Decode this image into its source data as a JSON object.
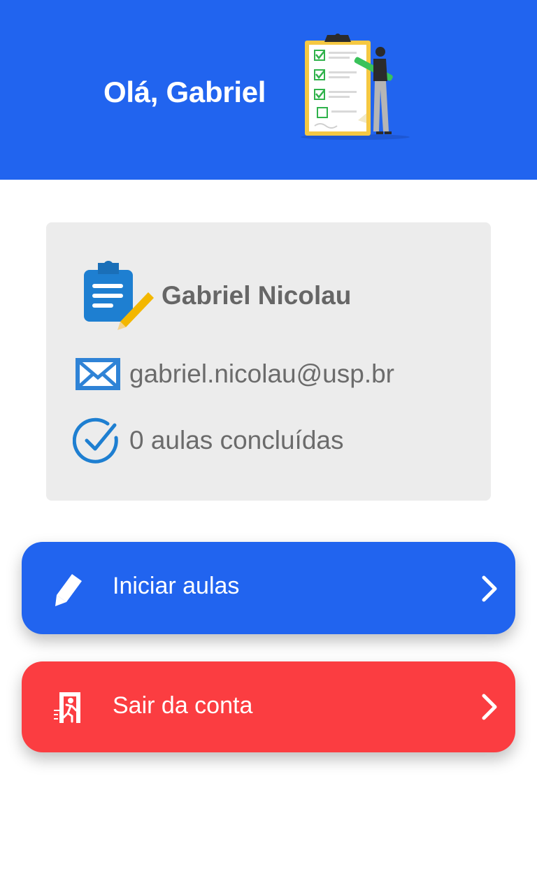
{
  "header": {
    "greeting": "Olá, Gabriel",
    "illustration_icon": "checklist-illustration-icon",
    "background_color": "#2164ef"
  },
  "profile": {
    "name": "Gabriel Nicolau",
    "email": "gabriel.nicolau@usp.br",
    "lessons_completed": "0 aulas concluídas",
    "icons": {
      "name": "clipboard-pencil-icon",
      "email": "envelope-icon",
      "lessons": "checkmark-circle-icon"
    }
  },
  "actions": {
    "start": {
      "label": "Iniciar aulas",
      "icon": "pencil-icon",
      "color": "#2164ef"
    },
    "logout": {
      "label": "Sair da conta",
      "icon": "exit-door-icon",
      "color": "#fb3d41"
    }
  }
}
